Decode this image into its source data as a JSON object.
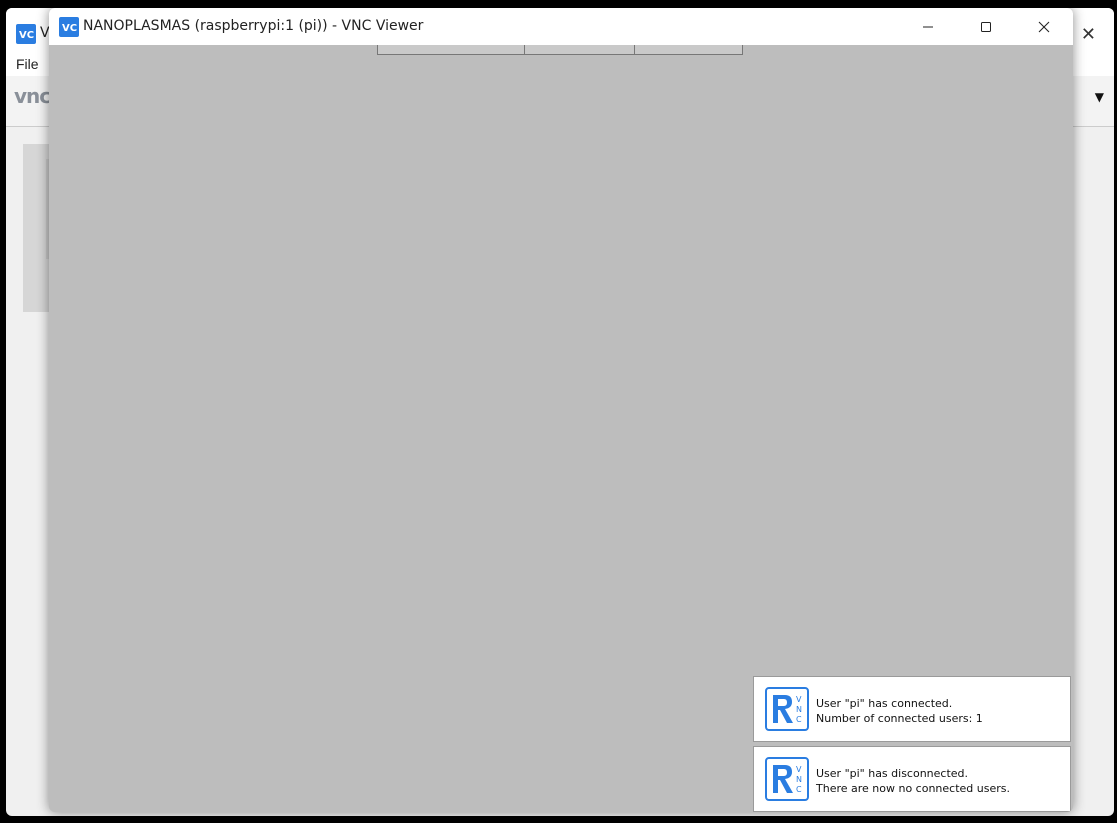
{
  "background_window": {
    "title": "V",
    "menu": {
      "file": "File"
    },
    "logo_text": "vnc"
  },
  "vnc_window": {
    "title": "NANOPLASMAS (raspberrypi:1 (pi)) - VNC Viewer",
    "buttons": {
      "minimize": "–",
      "maximize": "☐",
      "close": "✕"
    }
  },
  "notifications": [
    {
      "line1": "User \"pi\" has connected.",
      "line2": "Number of connected users: 1"
    },
    {
      "line1": "User \"pi\" has disconnected.",
      "line2": "There are now no connected users."
    }
  ],
  "colors": {
    "accent": "#2a7de1",
    "remote_desktop": "#bdbdbd"
  },
  "icons": {
    "app": "vnc-viewer-icon",
    "notification": "realvnc-icon"
  }
}
